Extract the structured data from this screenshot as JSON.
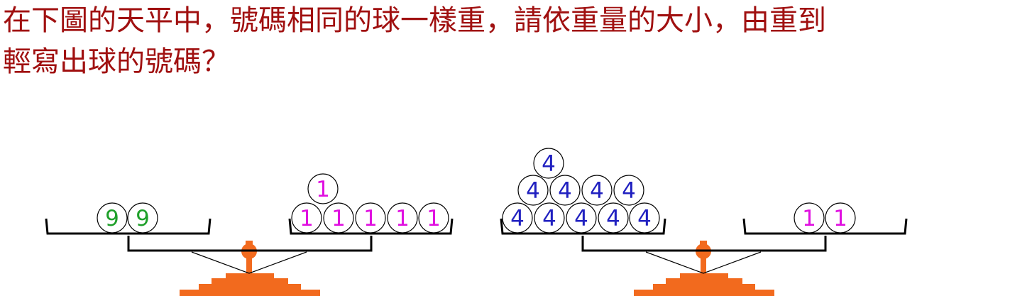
{
  "question": {
    "line1": "在下圖的天平中，號碼相同的球一樣重，請依重量的大小，由重到",
    "line2": "輕寫出球的號碼？"
  },
  "colors": {
    "question_text": "#a01010",
    "scale_body": "#f26a1e",
    "ball_9": "#1fa02a",
    "ball_1": "#e010e0",
    "ball_4": "#2020c0"
  },
  "balance_1": {
    "left_pan": [
      "9",
      "9"
    ],
    "right_pan": [
      "1",
      "1",
      "1",
      "1",
      "1",
      "1"
    ]
  },
  "balance_2": {
    "left_pan": [
      "4",
      "4",
      "4",
      "4",
      "4",
      "4",
      "4",
      "4",
      "4",
      "4"
    ],
    "right_pan": [
      "1",
      "1"
    ]
  }
}
